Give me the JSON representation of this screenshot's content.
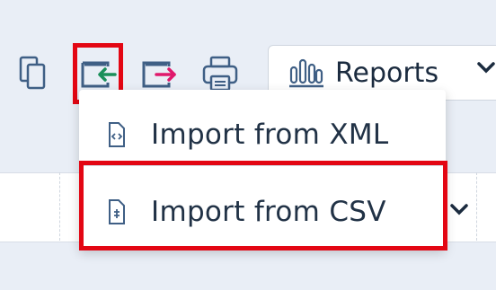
{
  "toolbar": {
    "reports_label": "Reports",
    "icons": [
      "copy-icon",
      "import-icon",
      "export-icon",
      "print-icon",
      "chart-icon",
      "chevron-down-icon"
    ]
  },
  "menu": {
    "items": [
      {
        "label": "Import from XML",
        "icon": "xml-file-icon"
      },
      {
        "label": "Import from CSV",
        "icon": "csv-file-icon"
      }
    ]
  },
  "colors": {
    "highlight": "#e30613",
    "import_green": "#1a8f5a",
    "export_pink": "#e0196c",
    "icon_blue": "#3f5f85"
  }
}
